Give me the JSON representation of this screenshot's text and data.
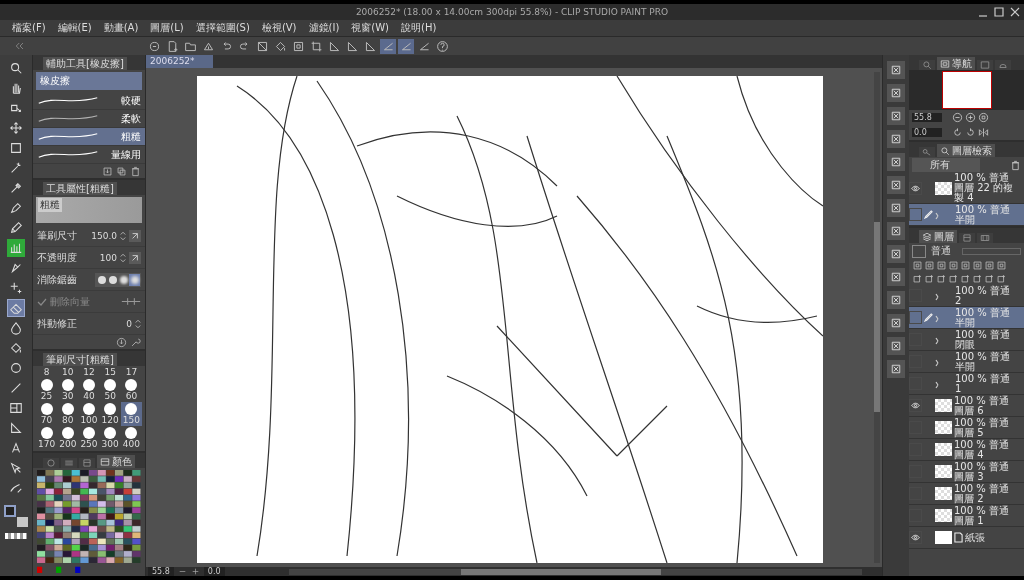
{
  "window": {
    "title": "2006252* (18.00 x 14.00cm 300dpi 55.8%)  - CLIP STUDIO PAINT PRO"
  },
  "menu": [
    "檔案(F)",
    "編輯(E)",
    "動畫(A)",
    "圖層(L)",
    "選擇範圍(S)",
    "檢視(V)",
    "濾鏡(I)",
    "視窗(W)",
    "說明(H)"
  ],
  "command_bar": [
    {
      "kind": "app",
      "selected": false
    },
    {
      "kind": "new",
      "selected": false
    },
    {
      "kind": "open",
      "selected": false
    },
    {
      "kind": "save",
      "selected": false
    },
    {
      "kind": "undo",
      "selected": false
    },
    {
      "kind": "redo",
      "selected": false
    },
    {
      "kind": "clear",
      "selected": false
    },
    {
      "kind": "fill",
      "selected": false
    },
    {
      "kind": "transform",
      "selected": false
    },
    {
      "kind": "crop",
      "selected": false
    },
    {
      "kind": "ruler",
      "selected": false
    },
    {
      "kind": "ruler",
      "selected": false
    },
    {
      "kind": "ruler",
      "selected": false
    },
    {
      "kind": "snap",
      "selected": true
    },
    {
      "kind": "snap",
      "selected": true
    },
    {
      "kind": "snap",
      "selected": false
    },
    {
      "kind": "help",
      "selected": false
    }
  ],
  "tools": [
    {
      "kind": "zoom",
      "selected": false
    },
    {
      "kind": "hand",
      "selected": false
    },
    {
      "kind": "rotate",
      "selected": false
    },
    {
      "kind": "move",
      "selected": false
    },
    {
      "kind": "select",
      "selected": false
    },
    {
      "kind": "wand",
      "selected": false
    },
    {
      "kind": "eyedropper",
      "selected": false
    },
    {
      "kind": "pen",
      "selected": false
    },
    {
      "kind": "pencil",
      "selected": false
    },
    {
      "kind": "decoration",
      "selected": false
    },
    {
      "kind": "nib",
      "selected": false
    },
    {
      "kind": "sparkle",
      "selected": false
    },
    {
      "kind": "eraser",
      "selected": true
    },
    {
      "kind": "blend",
      "selected": false
    },
    {
      "kind": "fill",
      "selected": false
    },
    {
      "kind": "gradient",
      "selected": false
    },
    {
      "kind": "line",
      "selected": false
    },
    {
      "kind": "frame",
      "selected": false
    },
    {
      "kind": "ruler",
      "selected": false
    },
    {
      "kind": "text",
      "selected": false
    },
    {
      "kind": "operation",
      "selected": false
    },
    {
      "kind": "correct",
      "selected": false
    }
  ],
  "sub_tool_panel": {
    "tab": "輔助工具[橡皮擦]",
    "group": "橡皮擦",
    "items": [
      {
        "label": "較硬",
        "kind": "thin",
        "selected": false
      },
      {
        "label": "柔軟",
        "kind": "soft",
        "selected": false
      },
      {
        "label": "粗糙",
        "kind": "thick",
        "selected": true
      },
      {
        "label": "量線用",
        "kind": "thick",
        "selected": false
      }
    ]
  },
  "tool_property": {
    "tab": "工具屬性[粗糙]",
    "preview_label": "粗糙",
    "rows": [
      {
        "kind": "value",
        "label": "筆刷尺寸",
        "value": "150.0",
        "pressure_button": true
      },
      {
        "kind": "value",
        "label": "不透明度",
        "value": "100",
        "pressure_button": true
      },
      {
        "kind": "antialias",
        "label": "消除鋸齒",
        "options": [
          {
            "selected": false
          },
          {
            "selected": false
          },
          {
            "selected": false
          },
          {
            "selected": true
          }
        ]
      },
      {
        "kind": "checkbox",
        "label": "刪除向量",
        "checked": true,
        "disabled": true
      },
      {
        "kind": "value",
        "label": "抖動修正",
        "value": "0",
        "pressure_button": false
      }
    ]
  },
  "brush_size": {
    "tab": "筆刷尺寸[粗糙]",
    "labels_above": [
      "8",
      "10",
      "12",
      "15",
      "17"
    ],
    "sizes": [
      {
        "label": "25",
        "selected": false
      },
      {
        "label": "30",
        "selected": false
      },
      {
        "label": "40",
        "selected": false
      },
      {
        "label": "50",
        "selected": false
      },
      {
        "label": "60",
        "selected": false
      },
      {
        "label": "70",
        "selected": false
      },
      {
        "label": "80",
        "selected": false
      },
      {
        "label": "100",
        "selected": false
      },
      {
        "label": "120",
        "selected": false
      },
      {
        "label": "150",
        "selected": true
      },
      {
        "label": "170",
        "selected": false
      },
      {
        "label": "200",
        "selected": false
      },
      {
        "label": "250",
        "selected": false
      },
      {
        "label": "300",
        "selected": false
      },
      {
        "label": "400",
        "selected": false
      }
    ]
  },
  "color_panel": {
    "tabs": [
      {
        "kind": "wheel",
        "selected": false
      },
      {
        "kind": "sliders",
        "selected": false
      },
      {
        "kind": "history",
        "selected": false
      },
      {
        "kind": "set",
        "label": "顏色",
        "selected": true
      }
    ]
  },
  "canvas": {
    "tab": "2006252*"
  },
  "status_bar": {
    "zoom": "55.8",
    "angle": "0.0"
  },
  "navigator": {
    "tabs": [
      {
        "kind": "search",
        "selected": false
      },
      {
        "kind": "navigator",
        "label": "導航",
        "selected": true
      },
      {
        "kind": "subview",
        "selected": false
      },
      {
        "kind": "info",
        "selected": false
      }
    ],
    "zoom": "55.8",
    "angle": "0.0"
  },
  "layer_search": {
    "tabs": [
      {
        "kind": "property",
        "selected": false
      },
      {
        "kind": "search",
        "label": "圖層檢索",
        "selected": true
      }
    ],
    "filter": "所有",
    "layers": [
      {
        "kind": "raster",
        "mode": "100 % 普通",
        "name": "圖層 22 的複製 4",
        "visible": true,
        "selected": false,
        "editing": false
      },
      {
        "kind": "folder",
        "mode": "100 % 普通",
        "name": "半開",
        "visible": false,
        "selected": true,
        "editing": true
      }
    ]
  },
  "layer_panel": {
    "tabs": [
      {
        "kind": "layer",
        "label": "圖層",
        "selected": true
      },
      {
        "kind": "history",
        "selected": false
      },
      {
        "kind": "animation",
        "selected": false
      }
    ],
    "blend": "普通",
    "layers": [
      {
        "kind": "folder",
        "mode": "100 % 普通",
        "name": "2",
        "visible": false,
        "selected": false,
        "editing": false
      },
      {
        "kind": "folder",
        "mode": "100 % 普通",
        "name": "半開",
        "visible": false,
        "selected": true,
        "editing": true
      },
      {
        "kind": "folder",
        "mode": "100 % 普通",
        "name": "閉眼",
        "visible": false,
        "selected": false,
        "editing": false
      },
      {
        "kind": "folder",
        "mode": "100 % 普通",
        "name": "半開",
        "visible": false,
        "selected": false,
        "editing": false
      },
      {
        "kind": "folder",
        "mode": "100 % 普通",
        "name": "1",
        "visible": false,
        "selected": false,
        "editing": false
      },
      {
        "kind": "raster",
        "mode": "100 % 普通",
        "name": "圖層 6",
        "visible": true,
        "selected": false,
        "editing": false
      },
      {
        "kind": "raster",
        "mode": "100 % 普通",
        "name": "圖層 5",
        "visible": false,
        "selected": false,
        "editing": false
      },
      {
        "kind": "raster",
        "mode": "100 % 普通",
        "name": "圖層 4",
        "visible": false,
        "selected": false,
        "editing": false
      },
      {
        "kind": "raster",
        "mode": "100 % 普通",
        "name": "圖層 3",
        "visible": false,
        "selected": false,
        "editing": false
      },
      {
        "kind": "raster",
        "mode": "100 % 普通",
        "name": "圖層 2",
        "visible": false,
        "selected": false,
        "editing": false
      },
      {
        "kind": "raster",
        "mode": "100 % 普通",
        "name": "圖層 1",
        "visible": false,
        "selected": false,
        "editing": false
      },
      {
        "kind": "paper",
        "name": "紙張",
        "visible": true,
        "selected": false,
        "editing": false
      }
    ]
  }
}
